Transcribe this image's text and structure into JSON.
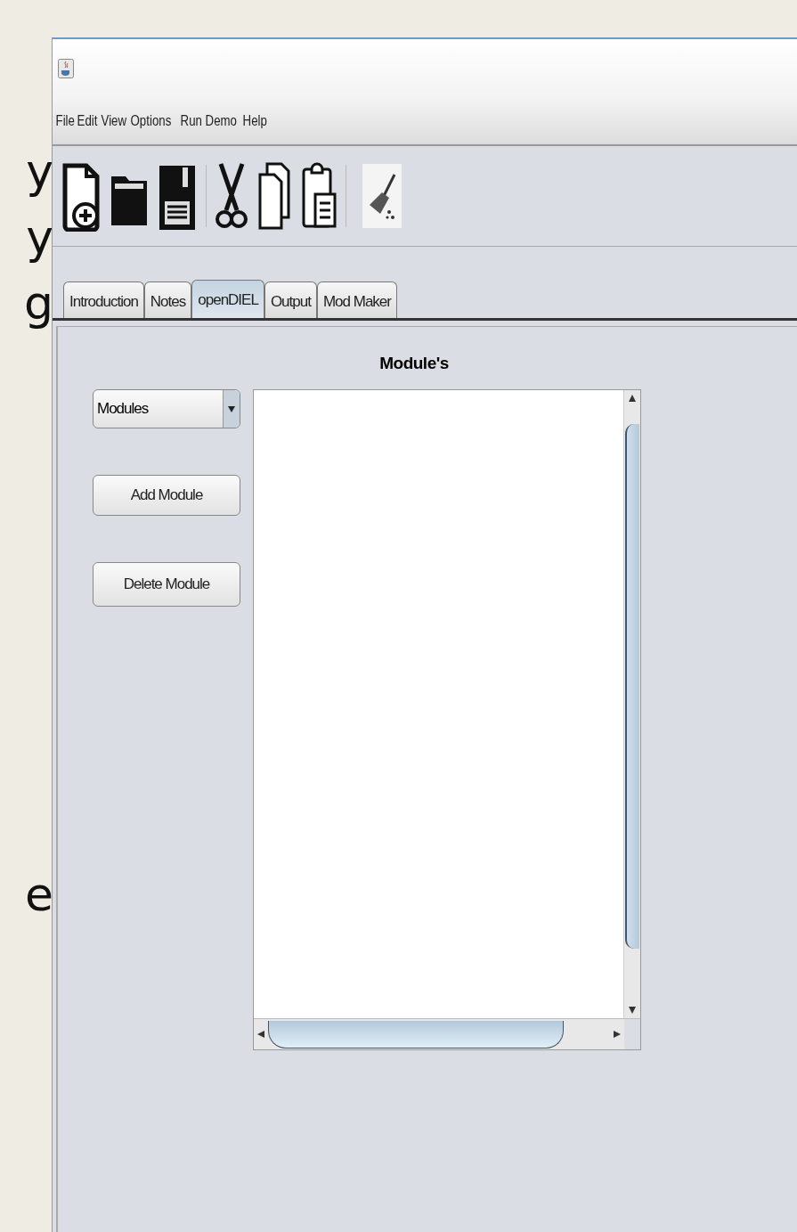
{
  "slide_fragments": [
    "y",
    "y",
    "g",
    "e"
  ],
  "menu": [
    "File",
    "Edit",
    "View",
    "Options",
    "Run",
    "Demo",
    "Help"
  ],
  "toolbar": [
    {
      "kind": "new"
    },
    {
      "kind": "open"
    },
    {
      "kind": "save"
    },
    {
      "kind": "sep"
    },
    {
      "kind": "cut"
    },
    {
      "kind": "copy"
    },
    {
      "kind": "paste"
    },
    {
      "kind": "sep"
    },
    {
      "kind": "clear"
    }
  ],
  "tabs": [
    {
      "label": "Introduction",
      "selected": false
    },
    {
      "label": "Notes",
      "selected": false
    },
    {
      "label": "openDIEL",
      "selected": true
    },
    {
      "label": "Output",
      "selected": false
    },
    {
      "label": "Mod Maker",
      "selected": false
    }
  ],
  "panel": {
    "title": "Module's",
    "dropdown": {
      "value": "Modules"
    },
    "buttons": [
      "Add Module",
      "Delete Module"
    ]
  }
}
